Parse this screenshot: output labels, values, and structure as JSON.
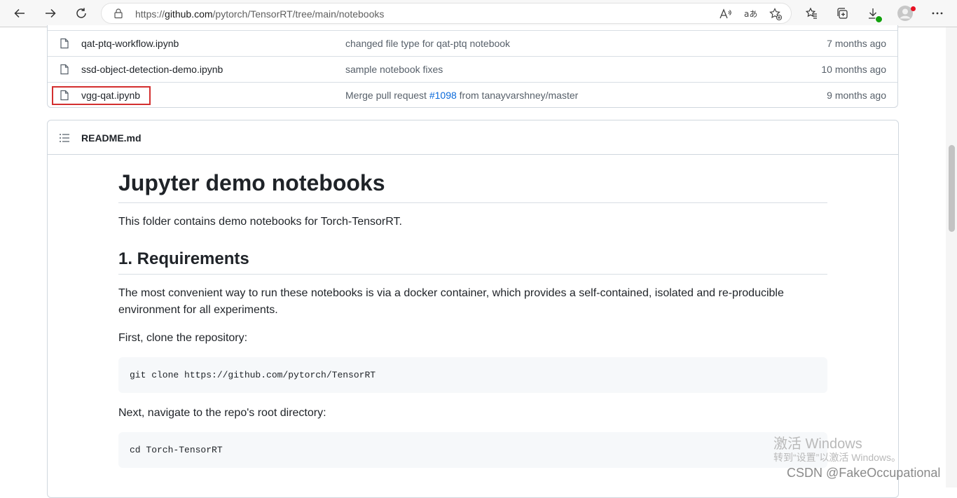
{
  "browser": {
    "url_prefix": "https://",
    "url_domain": "github.com",
    "url_path": "/pytorch/TensorRT/tree/main/notebooks"
  },
  "files": [
    {
      "name": "qat-ptq-workflow.ipynb",
      "message": "changed file type for qat-ptq notebook",
      "age": "7 months ago"
    },
    {
      "name": "ssd-object-detection-demo.ipynb",
      "message": "sample notebook fixes",
      "age": "10 months ago"
    },
    {
      "name": "vgg-qat.ipynb",
      "message_pre": "Merge pull request ",
      "pr": "#1098",
      "message_post": " from tanayvarshney/master",
      "age": "9 months ago"
    }
  ],
  "readme": {
    "filename": "README.md",
    "h1": "Jupyter demo notebooks",
    "intro": "This folder contains demo notebooks for Torch-TensorRT.",
    "h2": "1. Requirements",
    "req_text": "The most convenient way to run these notebooks is via a docker container, which provides a self-contained, isolated and re-producible environment for all experiments.",
    "clone_text": "First, clone the repository:",
    "clone_cmd": "git clone https://github.com/pytorch/TensorRT",
    "nav_text": "Next, navigate to the repo's root directory:",
    "nav_cmd": "cd Torch-TensorRT"
  },
  "overlay": {
    "activate_title": "激活 Windows",
    "activate_sub": "转到“设置”以激活 Windows。",
    "watermark": "CSDN @FakeOccupational"
  },
  "colors": {
    "link": "#0969da",
    "highlight_box": "#d32f2f",
    "border": "#d0d7de"
  }
}
